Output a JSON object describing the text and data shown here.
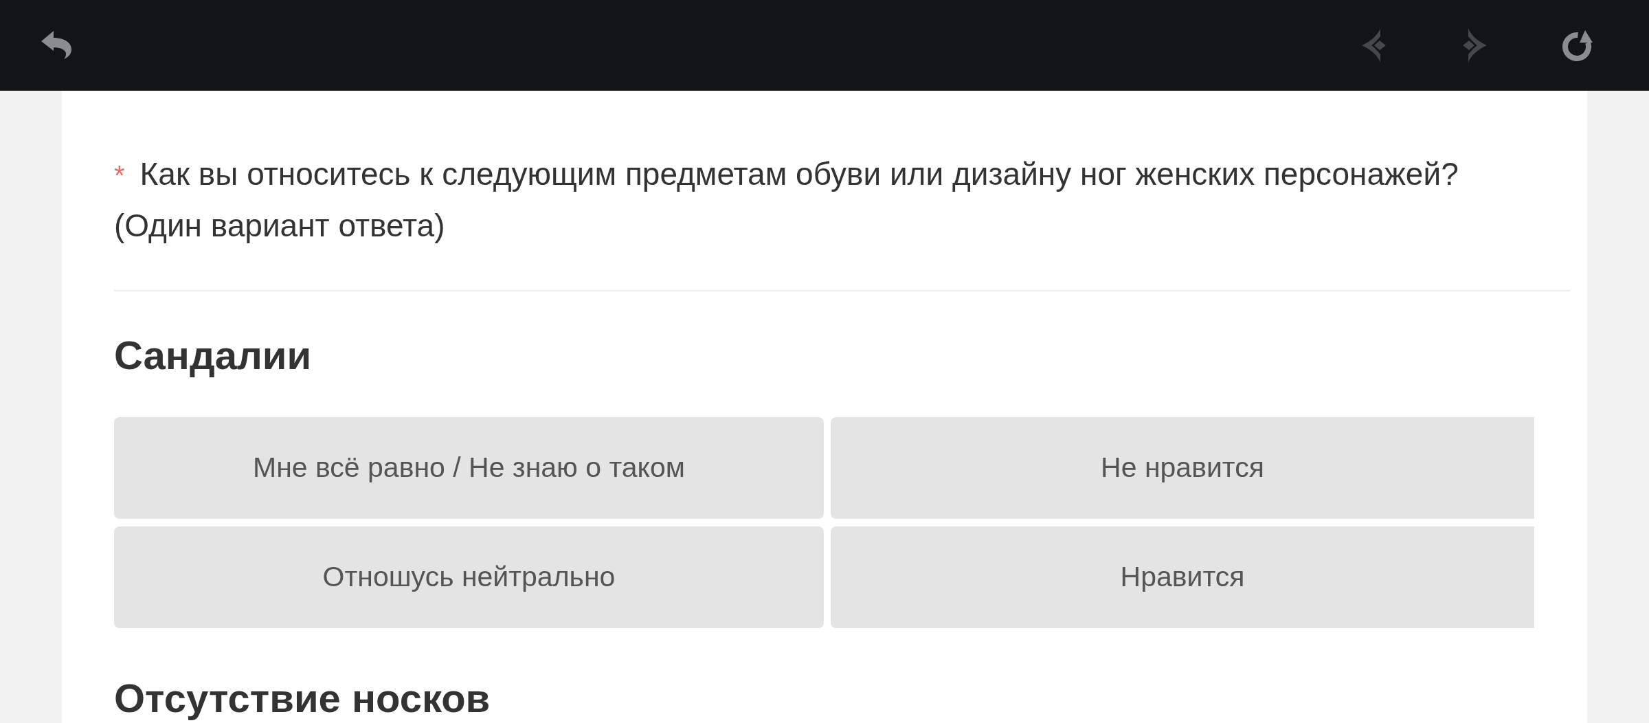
{
  "toolbar": {
    "left": [
      {
        "kind": "back",
        "disabled": false
      }
    ],
    "right": [
      {
        "kind": "previous",
        "disabled": true
      },
      {
        "kind": "next",
        "disabled": true
      },
      {
        "kind": "reload",
        "disabled": false
      }
    ]
  },
  "question": {
    "required_mark": "*",
    "text": "Как вы относитесь к следующим предметам обуви или дизайну ног женских персонажей?",
    "hint": "(Один вариант ответа)"
  },
  "items": [
    {
      "title": "Сандалии",
      "options": [
        {
          "label": "Мне всё равно / Не знаю о таком",
          "selected": false
        },
        {
          "label": "Не нравится",
          "selected": false
        },
        {
          "label": "Отношусь нейтрально",
          "selected": false
        },
        {
          "label": "Нравится",
          "selected": false
        }
      ]
    },
    {
      "title": "Отсутствие носков"
    }
  ]
}
